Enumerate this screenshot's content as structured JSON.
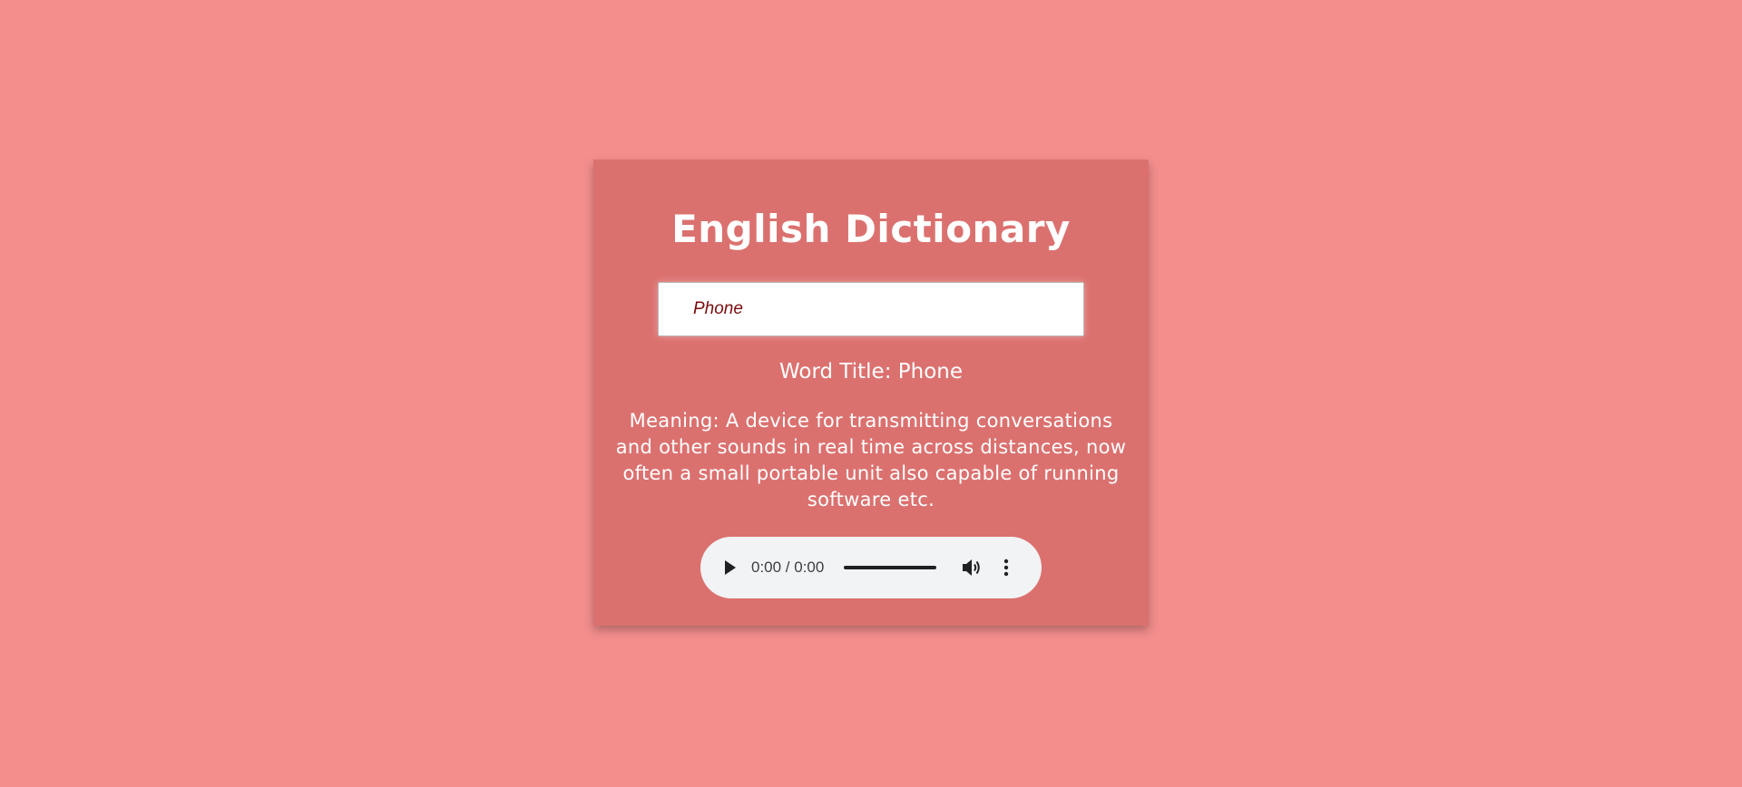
{
  "app": {
    "title": "English Dictionary"
  },
  "search": {
    "value": "Phone",
    "placeholder": ""
  },
  "result": {
    "word_title": "Word Title: Phone",
    "meaning": "Meaning: A device for transmitting conversations and other sounds in real time across distances, now often a small portable unit also capable of running software etc."
  },
  "audio_player": {
    "time": "0:00 / 0:00",
    "progress": 0,
    "icons": {
      "play": "play-icon",
      "volume": "volume-icon",
      "more": "more-options-icon"
    }
  },
  "colors": {
    "page_background": "#f38e8d",
    "card_background": "#db716f",
    "text": "#ffffff",
    "search_text": "#7a0c0c",
    "player_background": "#f1f3f4"
  }
}
